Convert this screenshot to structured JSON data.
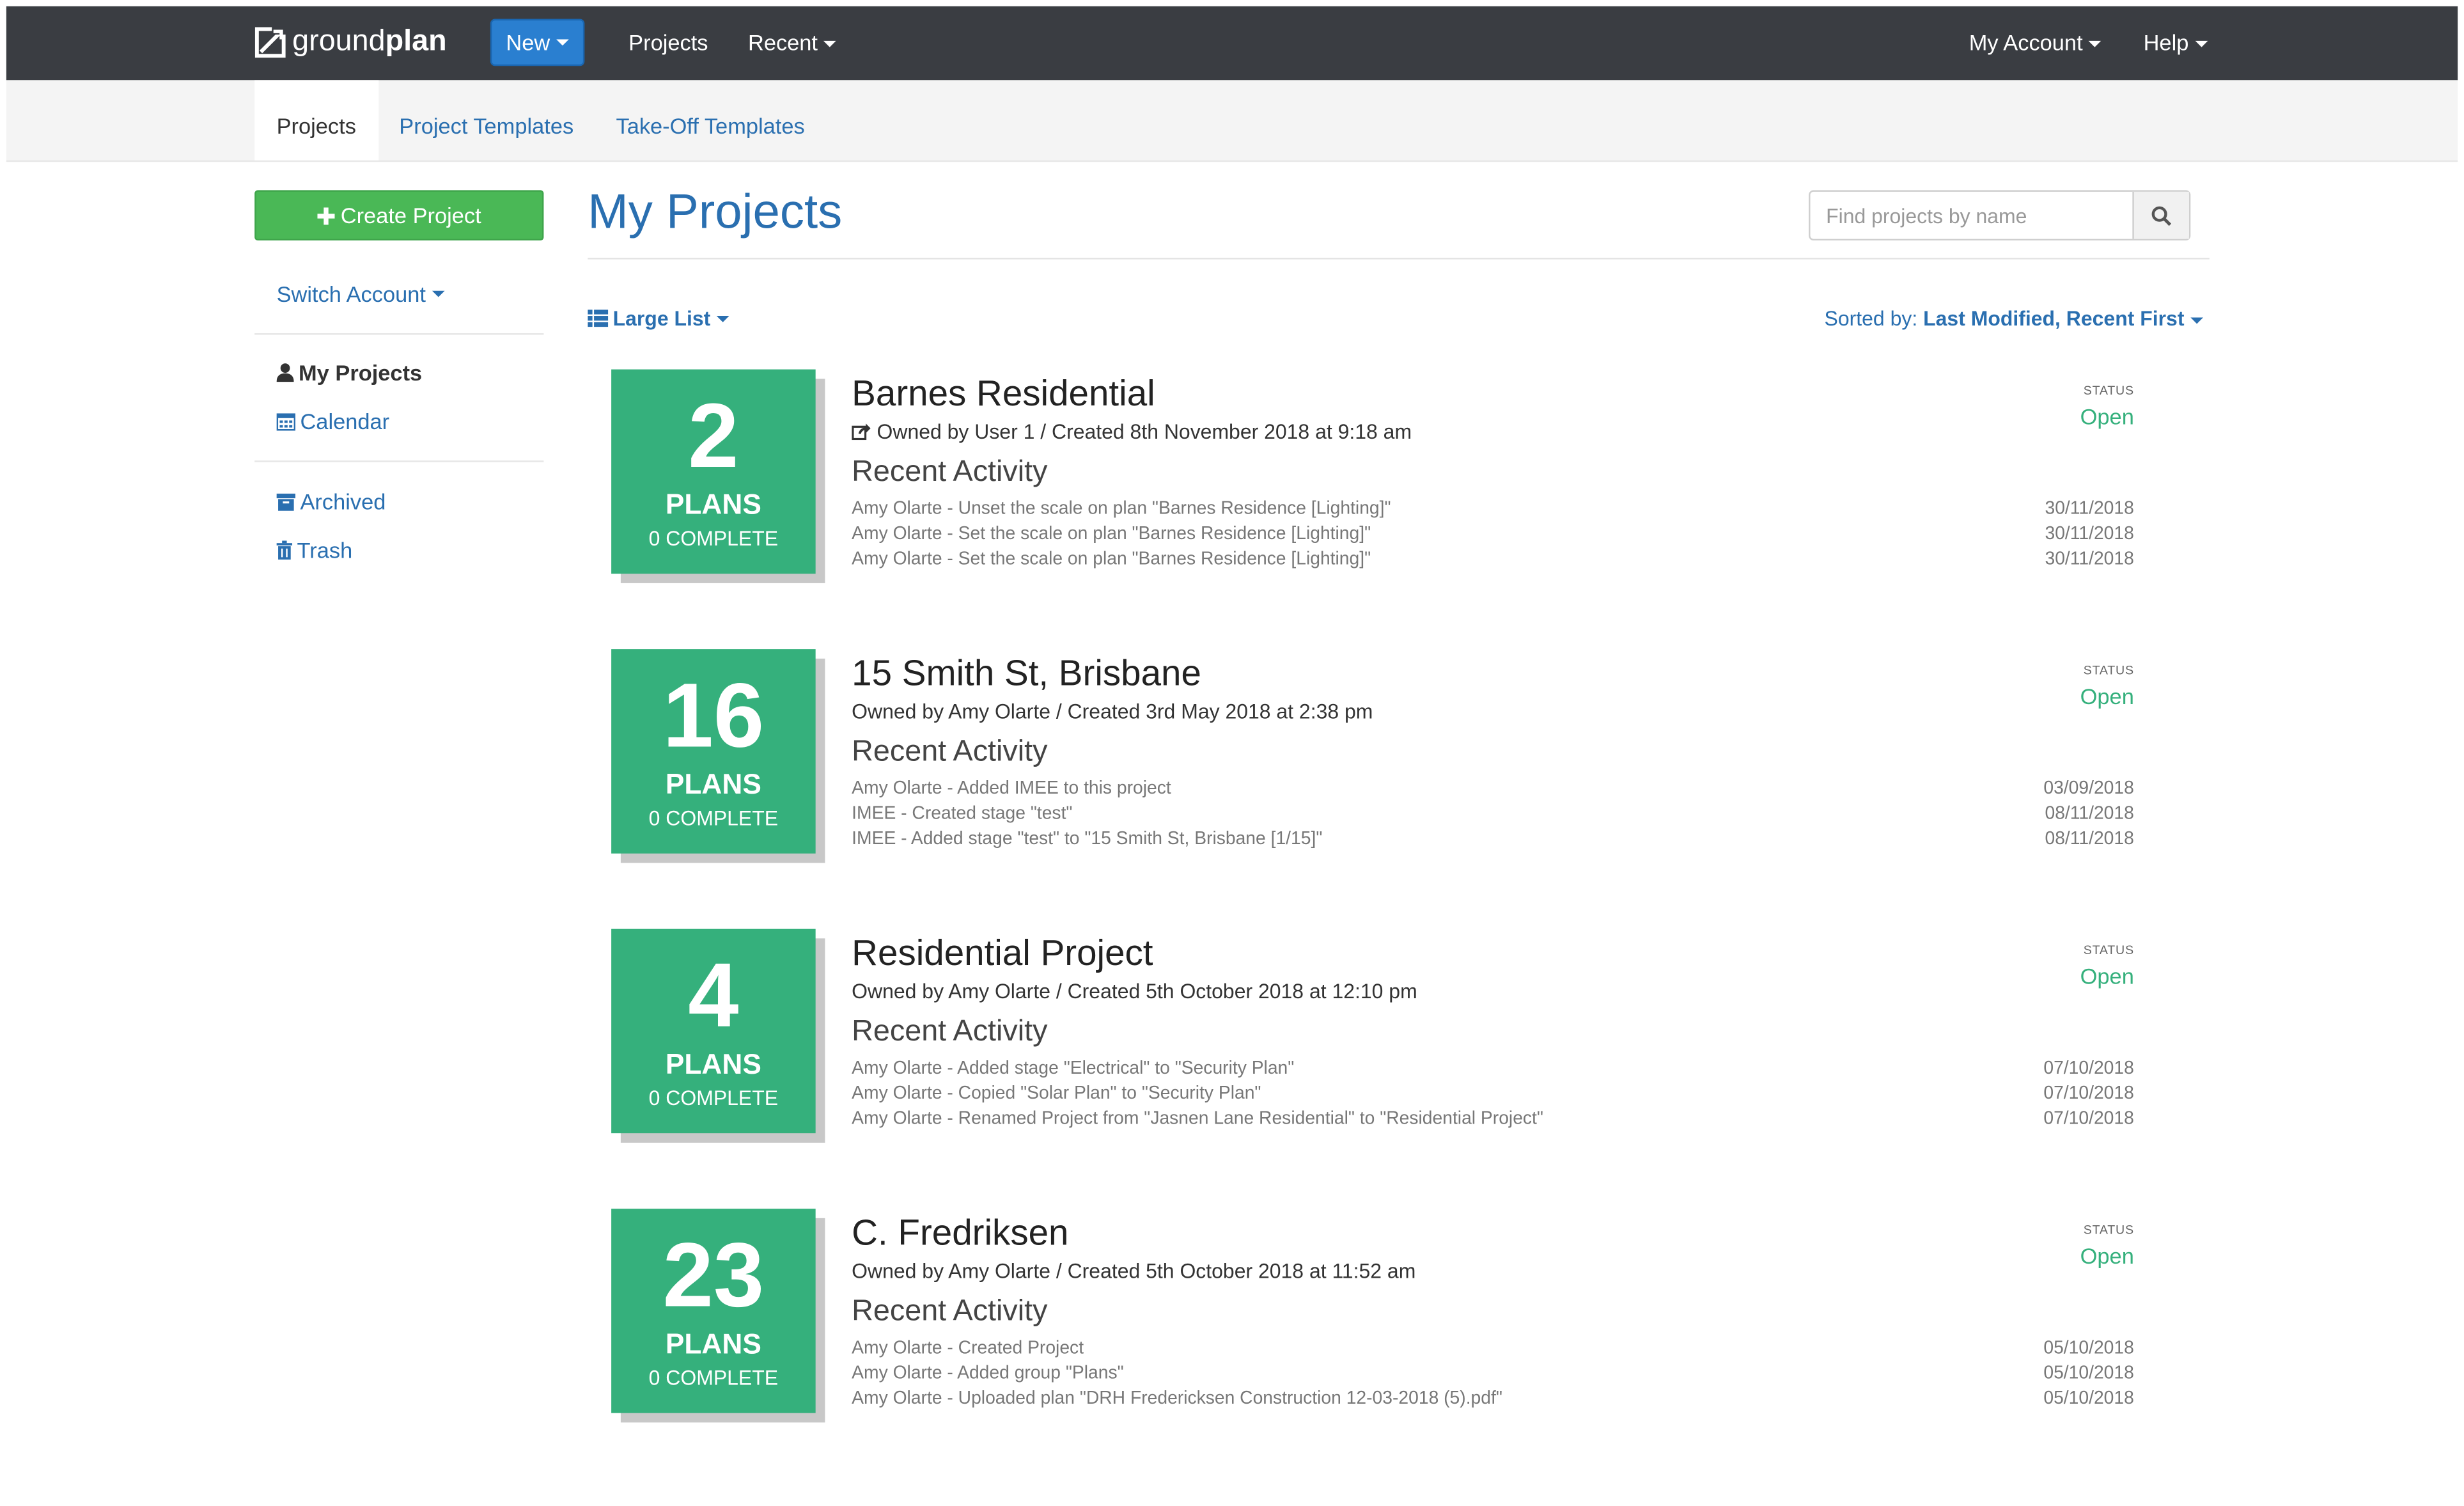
{
  "nav": {
    "brand_light": "ground",
    "brand_bold": "plan",
    "new_label": "New",
    "projects_label": "Projects",
    "recent_label": "Recent",
    "account_label": "My Account",
    "help_label": "Help"
  },
  "subnav": {
    "projects": "Projects",
    "project_templates": "Project Templates",
    "takeoff_templates": "Take-Off Templates"
  },
  "sidebar": {
    "create_label": "Create Project",
    "switch_account": "Switch Account",
    "my_projects": "My Projects",
    "calendar": "Calendar",
    "archived": "Archived",
    "trash": "Trash"
  },
  "main": {
    "title": "My Projects",
    "search_placeholder": "Find projects by name",
    "view_label": "Large List",
    "sort_prefix": "Sorted by:",
    "sort_value": "Last Modified, Recent First",
    "recent_activity_label": "Recent Activity",
    "status_label": "STATUS",
    "plans_label": "PLANS"
  },
  "colors": {
    "accent": "#2a6fb0",
    "tile": "#35b07c",
    "nav_bg": "#3a3d42",
    "new_button": "#2a7fd0",
    "create_button": "#4ab856"
  },
  "projects": [
    {
      "plans": "2",
      "complete": "0 COMPLETE",
      "title": "Barnes Residential",
      "owner": "Owned by User 1 / Created 8th November 2018 at 9:18 am",
      "status": "Open",
      "activities": [
        {
          "text": "Amy Olarte - Unset the scale on plan \"Barnes Residence [Lighting]\"",
          "date": "30/11/2018"
        },
        {
          "text": "Amy Olarte - Set the scale on plan \"Barnes Residence [Lighting]\"",
          "date": "30/11/2018"
        },
        {
          "text": "Amy Olarte - Set the scale on plan \"Barnes Residence [Lighting]\"",
          "date": "30/11/2018"
        }
      ]
    },
    {
      "plans": "16",
      "complete": "0 COMPLETE",
      "title": "15 Smith St, Brisbane",
      "owner": "Owned by Amy Olarte / Created 3rd May 2018 at 2:38 pm",
      "status": "Open",
      "activities": [
        {
          "text": "Amy Olarte - Added IMEE to this project",
          "date": "03/09/2018"
        },
        {
          "text": "IMEE - Created stage \"test\"",
          "date": "08/11/2018"
        },
        {
          "text": "IMEE - Added stage \"test\" to \"15 Smith St, Brisbane [1/15]\"",
          "date": "08/11/2018"
        }
      ]
    },
    {
      "plans": "4",
      "complete": "0 COMPLETE",
      "title": "Residential Project",
      "owner": "Owned by Amy Olarte / Created 5th October 2018 at 12:10 pm",
      "status": "Open",
      "activities": [
        {
          "text": "Amy Olarte - Added stage \"Electrical\" to \"Security Plan\"",
          "date": "07/10/2018"
        },
        {
          "text": "Amy Olarte - Copied \"Solar Plan\" to \"Security Plan\"",
          "date": "07/10/2018"
        },
        {
          "text": "Amy Olarte - Renamed Project from \"Jasnen Lane Residential\" to \"Residential Project\"",
          "date": "07/10/2018"
        }
      ]
    },
    {
      "plans": "23",
      "complete": "0 COMPLETE",
      "title": "C. Fredriksen",
      "owner": "Owned by Amy Olarte / Created 5th October 2018 at 11:52 am",
      "status": "Open",
      "activities": [
        {
          "text": "Amy Olarte - Created Project",
          "date": "05/10/2018"
        },
        {
          "text": "Amy Olarte - Added group \"Plans\"",
          "date": "05/10/2018"
        },
        {
          "text": "Amy Olarte - Uploaded plan \"DRH Fredericksen Construction 12-03-2018 (5).pdf\"",
          "date": "05/10/2018"
        }
      ]
    }
  ]
}
